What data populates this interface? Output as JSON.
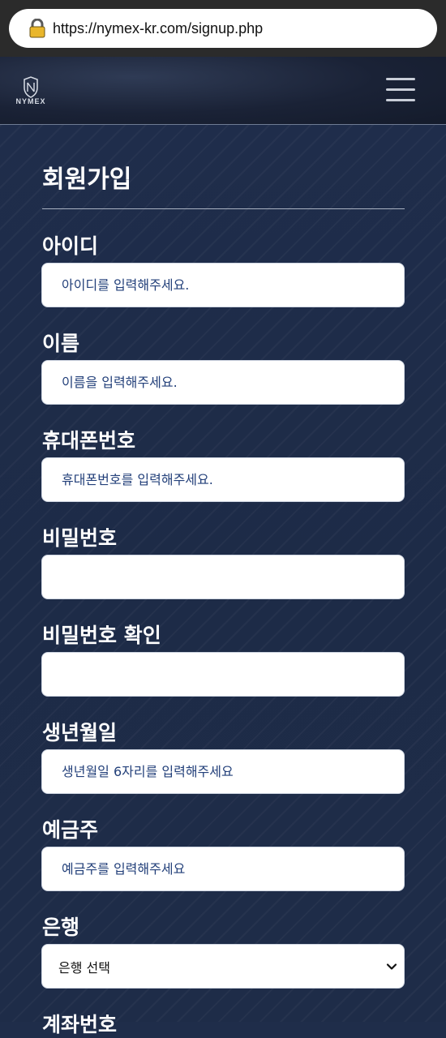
{
  "browser": {
    "url": "https://nymex-kr.com/signup.php"
  },
  "header": {
    "logo_text": "NYMEX"
  },
  "form": {
    "title": "회원가입",
    "fields": [
      {
        "label": "아이디",
        "placeholder": "아이디를 입력해주세요."
      },
      {
        "label": "이름",
        "placeholder": "이름을 입력해주세요."
      },
      {
        "label": "휴대폰번호",
        "placeholder": "휴대폰번호를 입력해주세요."
      },
      {
        "label": "비밀번호",
        "placeholder": ""
      },
      {
        "label": "비밀번호 확인",
        "placeholder": ""
      },
      {
        "label": "생년월일",
        "placeholder": "생년월일 6자리를 입력해주세요"
      },
      {
        "label": "예금주",
        "placeholder": "예금주를 입력해주세요"
      }
    ],
    "bank": {
      "label": "은행",
      "selected": "은행 선택"
    },
    "account_label": "계좌번호"
  }
}
